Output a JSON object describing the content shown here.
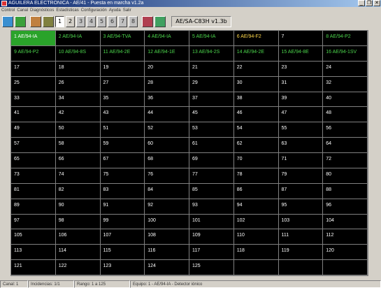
{
  "window": {
    "title": "AGUILERA ELECTRONICA - AE/41 - Puesta en marcha v1.2a",
    "controls": [
      "_",
      "❐",
      "✕"
    ]
  },
  "menu": [
    "Control",
    "Canal",
    "Diagnósticos",
    "Estadísticas",
    "Configuración",
    "Ayuda",
    "Salir"
  ],
  "toolbar": {
    "icons": [
      "connect-icon",
      "door-icon",
      "people-icon",
      "tools-icon"
    ],
    "pages": [
      "1",
      "2",
      "3",
      "4",
      "5",
      "6",
      "7",
      "8"
    ],
    "active_page": "1",
    "extra_icons": [
      "book-icon",
      "exit-icon"
    ],
    "version": "AE/SA-C83H v1.3b"
  },
  "grid": {
    "rows": [
      [
        {
          "label": "1 AE/94-IA",
          "style": "selected"
        },
        {
          "label": "2 AE/94-IA",
          "style": "green"
        },
        {
          "label": "3 AE/94-TVA",
          "style": "green"
        },
        {
          "label": "4 AE/94-IA",
          "style": "green"
        },
        {
          "label": "5 AE/94-IA",
          "style": "green"
        },
        {
          "label": "6 AE/94-F2",
          "style": "yellow"
        },
        {
          "label": "7",
          "style": "white"
        },
        {
          "label": "8 AE/94-P2",
          "style": "green"
        }
      ],
      [
        {
          "label": "9 AE/94-P2",
          "style": "green"
        },
        {
          "label": "10 AE/94-8S",
          "style": "green"
        },
        {
          "label": "11 AE/94-2E",
          "style": "green"
        },
        {
          "label": "12 AE/94-1E",
          "style": "green"
        },
        {
          "label": "13 AE/94-2S",
          "style": "green"
        },
        {
          "label": "14 AE/94-2E",
          "style": "green"
        },
        {
          "label": "15 AE/94-8E",
          "style": "green"
        },
        {
          "label": "16 AE/94-1SV",
          "style": "green"
        }
      ],
      [
        {
          "label": "17"
        },
        {
          "label": "18"
        },
        {
          "label": "19"
        },
        {
          "label": "20"
        },
        {
          "label": "21"
        },
        {
          "label": "22"
        },
        {
          "label": "23"
        },
        {
          "label": "24"
        }
      ],
      [
        {
          "label": "25"
        },
        {
          "label": "26"
        },
        {
          "label": "27"
        },
        {
          "label": "28"
        },
        {
          "label": "29"
        },
        {
          "label": "30"
        },
        {
          "label": "31"
        },
        {
          "label": "32"
        }
      ],
      [
        {
          "label": "33"
        },
        {
          "label": "34"
        },
        {
          "label": "35"
        },
        {
          "label": "36"
        },
        {
          "label": "37"
        },
        {
          "label": "38"
        },
        {
          "label": "39"
        },
        {
          "label": "40"
        }
      ],
      [
        {
          "label": "41"
        },
        {
          "label": "42"
        },
        {
          "label": "43"
        },
        {
          "label": "44"
        },
        {
          "label": "45"
        },
        {
          "label": "46"
        },
        {
          "label": "47"
        },
        {
          "label": "48"
        }
      ],
      [
        {
          "label": "49"
        },
        {
          "label": "50"
        },
        {
          "label": "51"
        },
        {
          "label": "52"
        },
        {
          "label": "53"
        },
        {
          "label": "54"
        },
        {
          "label": "55"
        },
        {
          "label": "56"
        }
      ],
      [
        {
          "label": "57"
        },
        {
          "label": "58"
        },
        {
          "label": "59"
        },
        {
          "label": "60"
        },
        {
          "label": "61"
        },
        {
          "label": "62"
        },
        {
          "label": "63"
        },
        {
          "label": "64"
        }
      ],
      [
        {
          "label": "65"
        },
        {
          "label": "66"
        },
        {
          "label": "67"
        },
        {
          "label": "68"
        },
        {
          "label": "69"
        },
        {
          "label": "70"
        },
        {
          "label": "71"
        },
        {
          "label": "72"
        }
      ],
      [
        {
          "label": "73"
        },
        {
          "label": "74"
        },
        {
          "label": "75"
        },
        {
          "label": "76"
        },
        {
          "label": "77"
        },
        {
          "label": "78"
        },
        {
          "label": "79"
        },
        {
          "label": "80"
        }
      ],
      [
        {
          "label": "81"
        },
        {
          "label": "82"
        },
        {
          "label": "83"
        },
        {
          "label": "84"
        },
        {
          "label": "85"
        },
        {
          "label": "86"
        },
        {
          "label": "87"
        },
        {
          "label": "88"
        }
      ],
      [
        {
          "label": "89"
        },
        {
          "label": "90"
        },
        {
          "label": "91"
        },
        {
          "label": "92"
        },
        {
          "label": "93"
        },
        {
          "label": "94"
        },
        {
          "label": "95"
        },
        {
          "label": "96"
        }
      ],
      [
        {
          "label": "97"
        },
        {
          "label": "98"
        },
        {
          "label": "99"
        },
        {
          "label": "100"
        },
        {
          "label": "101"
        },
        {
          "label": "102"
        },
        {
          "label": "103"
        },
        {
          "label": "104"
        }
      ],
      [
        {
          "label": "105"
        },
        {
          "label": "106"
        },
        {
          "label": "107"
        },
        {
          "label": "108"
        },
        {
          "label": "109"
        },
        {
          "label": "110"
        },
        {
          "label": "111"
        },
        {
          "label": "112"
        }
      ],
      [
        {
          "label": "113"
        },
        {
          "label": "114"
        },
        {
          "label": "115"
        },
        {
          "label": "116"
        },
        {
          "label": "117"
        },
        {
          "label": "118"
        },
        {
          "label": "119"
        },
        {
          "label": "120"
        }
      ],
      [
        {
          "label": "121"
        },
        {
          "label": "122"
        },
        {
          "label": "123"
        },
        {
          "label": "124"
        },
        {
          "label": "125"
        },
        {
          "label": ""
        },
        {
          "label": ""
        },
        {
          "label": ""
        }
      ]
    ]
  },
  "status": {
    "canal": "Canal: 1",
    "incidencias": "Incidencias: 1/1",
    "rango": "Rango: 1 a 125",
    "equipo": "Equipo: 1 - AE/94-IA - Detector iónico"
  },
  "colors": {
    "selected_bg": "#2aa32a",
    "configured_text": "#4cd64c",
    "alarm_text": "#ffd84a",
    "grid_bg": "#000000"
  }
}
